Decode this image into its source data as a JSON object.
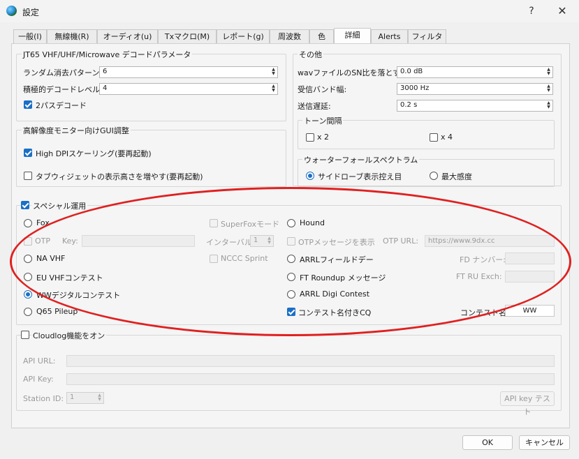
{
  "window": {
    "title": "設定",
    "help_glyph": "?",
    "close_glyph": "✕"
  },
  "tabs": [
    "一般(I)",
    "無線機(R)",
    "オーディオ(u)",
    "Txマクロ(M)",
    "レポート(g)",
    "周波数",
    "色",
    "詳細",
    "Alerts",
    "フィルタ"
  ],
  "active_tab": "詳細",
  "jt65": {
    "title": "JT65 VHF/UHF/Microwave デコードパラメータ",
    "random_erasure_label": "ランダム消去パターン:",
    "random_erasure_value": "6",
    "aggressive_label": "積極的デコードレベル:",
    "aggressive_value": "4",
    "two_pass_label": "2パスデコード",
    "two_pass_checked": true
  },
  "hidpi": {
    "title": "高解像度モニター向けGUI調整",
    "high_dpi_label": "High DPIスケーリング(要再起動)",
    "high_dpi_checked": true,
    "tab_height_label": "タブウィジェットの表示高さを増やす(要再起動)",
    "tab_height_checked": false
  },
  "misc": {
    "title": "その他",
    "wav_sn_label": "wavファイルのSN比を落とす:",
    "wav_sn_value": "0.0 dB",
    "rx_bw_label": "受信バンド幅:",
    "rx_bw_value": "3000  Hz",
    "tx_delay_label": "送信遅延:",
    "tx_delay_value": "0.2  s"
  },
  "tone_spacing": {
    "title": "トーン間隔",
    "x2_label": "x 2",
    "x4_label": "x 4"
  },
  "waterfall": {
    "title": "ウォーターフォールスペクトラム",
    "sidelobe_label": "サイドローブ表示控え目",
    "max_sens_label": "最大感度",
    "selected": "sidelobe"
  },
  "special": {
    "title": "スペシャル運用",
    "enabled": true,
    "fox_label": "Fox",
    "superfox_label": "SuperFoxモード",
    "hound_label": "Hound",
    "otp_label": "OTP",
    "key_label": "Key:",
    "interval_label": "インターバル",
    "interval_value": "1",
    "otp_show_label": "OTPメッセージを表示",
    "otp_url_label": "OTP URL:",
    "otp_url_value": "https://www.9dx.cc",
    "na_vhf_label": "NA VHF",
    "nccc_label": "NCCC Sprint",
    "arrl_field_label": "ARRLフィールドデー",
    "fd_number_label": "FD ナンバー:",
    "eu_vhf_label": "EU VHFコンテスト",
    "ft_roundup_label": "FT Roundup メッセージ",
    "ft_ru_exch_label": "FT RU Exch:",
    "ww_digi_label": "WWデジタルコンテスト",
    "arrl_digi_label": "ARRL Digi Contest",
    "q65_label": "Q65 Pileup",
    "contest_cq_label": "コンテスト名付きCQ",
    "contest_cq_checked": true,
    "contest_name_label": "コンテスト名:",
    "contest_name_value": "WW",
    "selected": "ww_digi"
  },
  "cloudlog": {
    "title": "Cloudlog機能をオン",
    "enabled": false,
    "api_url_label": "API URL:",
    "api_key_label": "API Key:",
    "station_id_label": "Station ID:",
    "station_id_value": "1",
    "test_button": "API key テスト"
  },
  "footer": {
    "ok_label": "OK",
    "cancel_label": "キャンセル"
  },
  "colors": {
    "accent": "#1a6fc6",
    "highlight": "#e02020"
  }
}
